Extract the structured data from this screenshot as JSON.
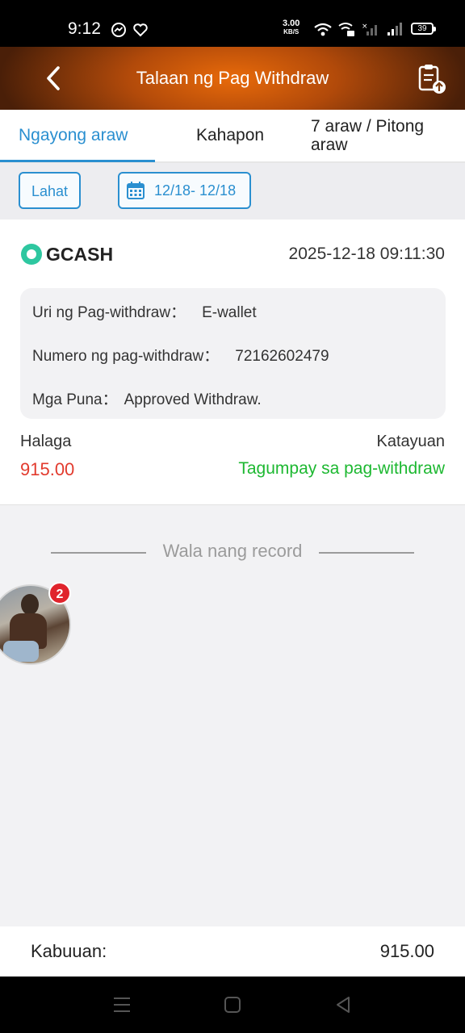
{
  "status_bar": {
    "time": "9:12",
    "net_speed_value": "3.00",
    "net_speed_unit": "KB/S",
    "battery": "39"
  },
  "header": {
    "title": "Talaan ng Pag Withdraw",
    "back_icon": "chevron-left-icon",
    "record_icon": "clipboard-upload-icon"
  },
  "tabs": [
    {
      "label": "Ngayong araw",
      "active": true
    },
    {
      "label": "Kahapon",
      "active": false
    },
    {
      "label": "7 araw / Pitong araw",
      "active": false
    }
  ],
  "filters": {
    "all_label": "Lahat",
    "date_range": "12/18- 12/18",
    "date_icon": "calendar-icon"
  },
  "record": {
    "provider": "GCASH",
    "datetime": "2025-12-18 09:11:30",
    "details": [
      {
        "label": "Uri ng Pag-withdraw：",
        "value": "E-wallet"
      },
      {
        "label": "Numero ng pag-withdraw：",
        "value": "72162602479"
      },
      {
        "label": "Mga Puna：",
        "value": "Approved Withdraw."
      }
    ],
    "amount_label": "Halaga",
    "amount": "915.00",
    "status_label": "Katayuan",
    "status": "Tagumpay sa pag-withdraw"
  },
  "no_more_records": "Wala nang record",
  "floating_chat": {
    "badge_count": "2"
  },
  "total": {
    "label": "Kabuuan:",
    "value": "915.00"
  },
  "colors": {
    "accent": "#2a8fd0",
    "amount": "#e23b2e",
    "success": "#1db831",
    "header_orange": "#e86a0a"
  }
}
